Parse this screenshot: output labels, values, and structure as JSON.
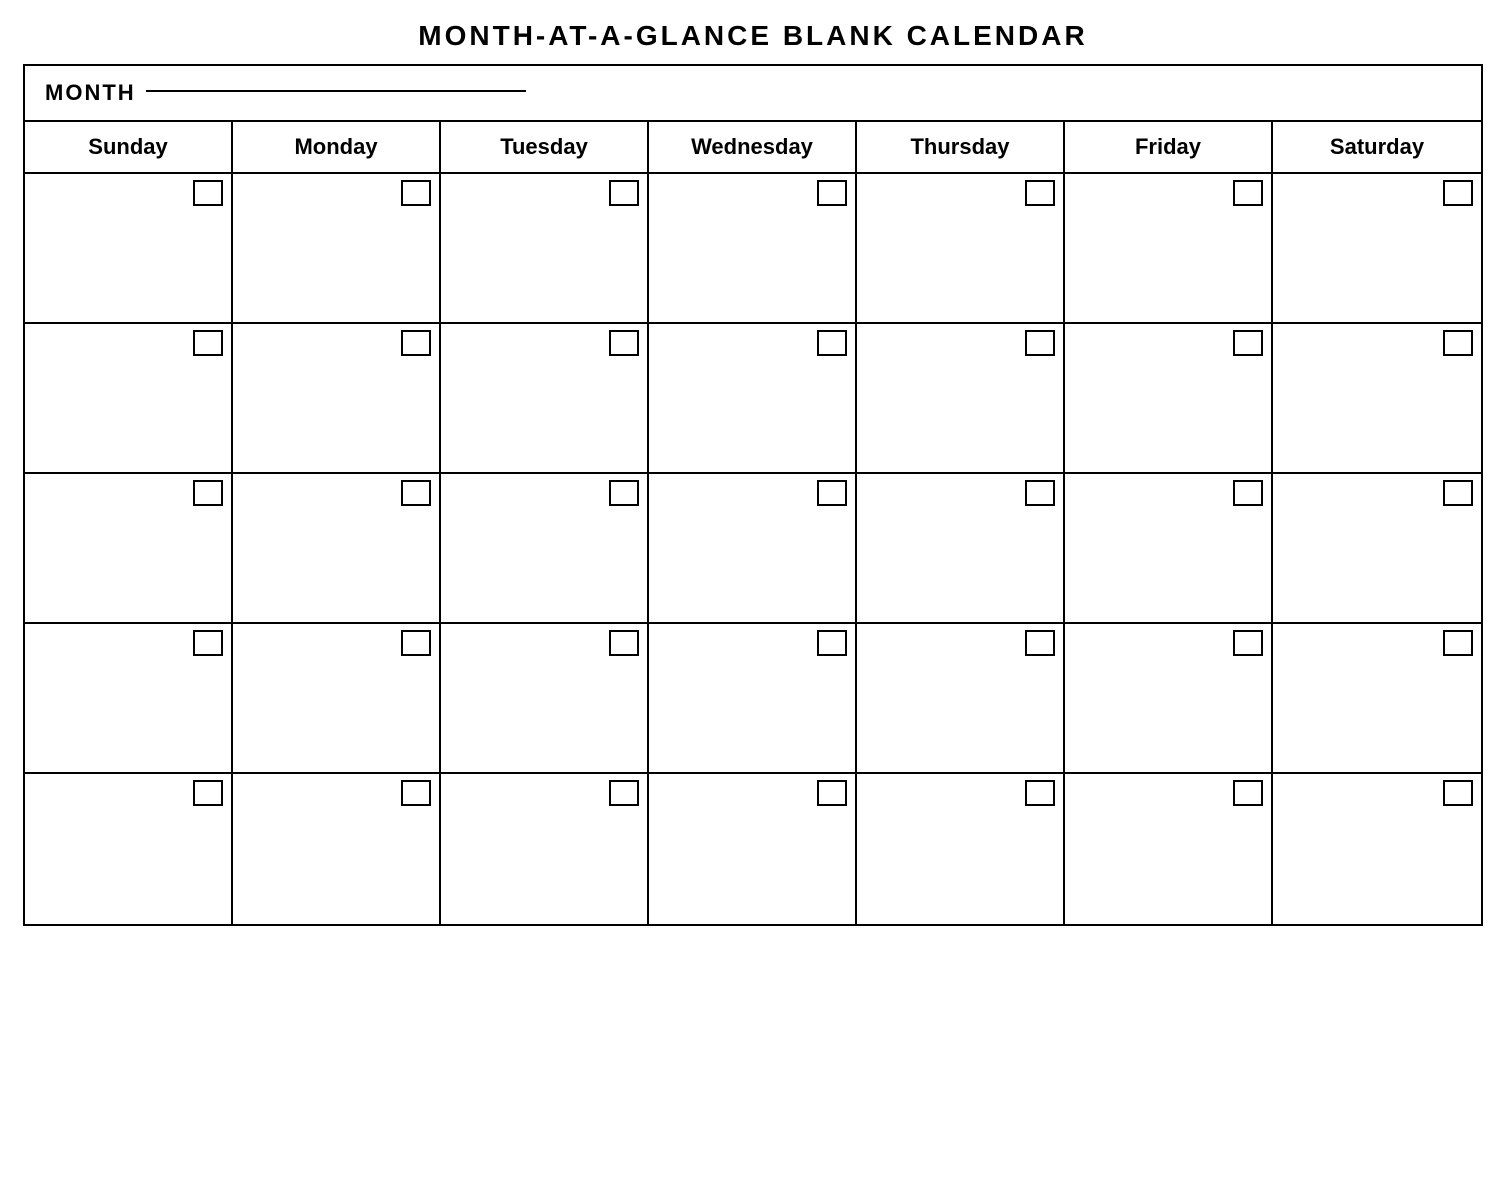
{
  "title": "MONTH-AT-A-GLANCE  BLANK  CALENDAR",
  "month_label": "MONTH",
  "days": [
    "Sunday",
    "Monday",
    "Tuesday",
    "Wednesday",
    "Thursday",
    "Friday",
    "Saturday"
  ],
  "rows": 5,
  "cols": 7
}
